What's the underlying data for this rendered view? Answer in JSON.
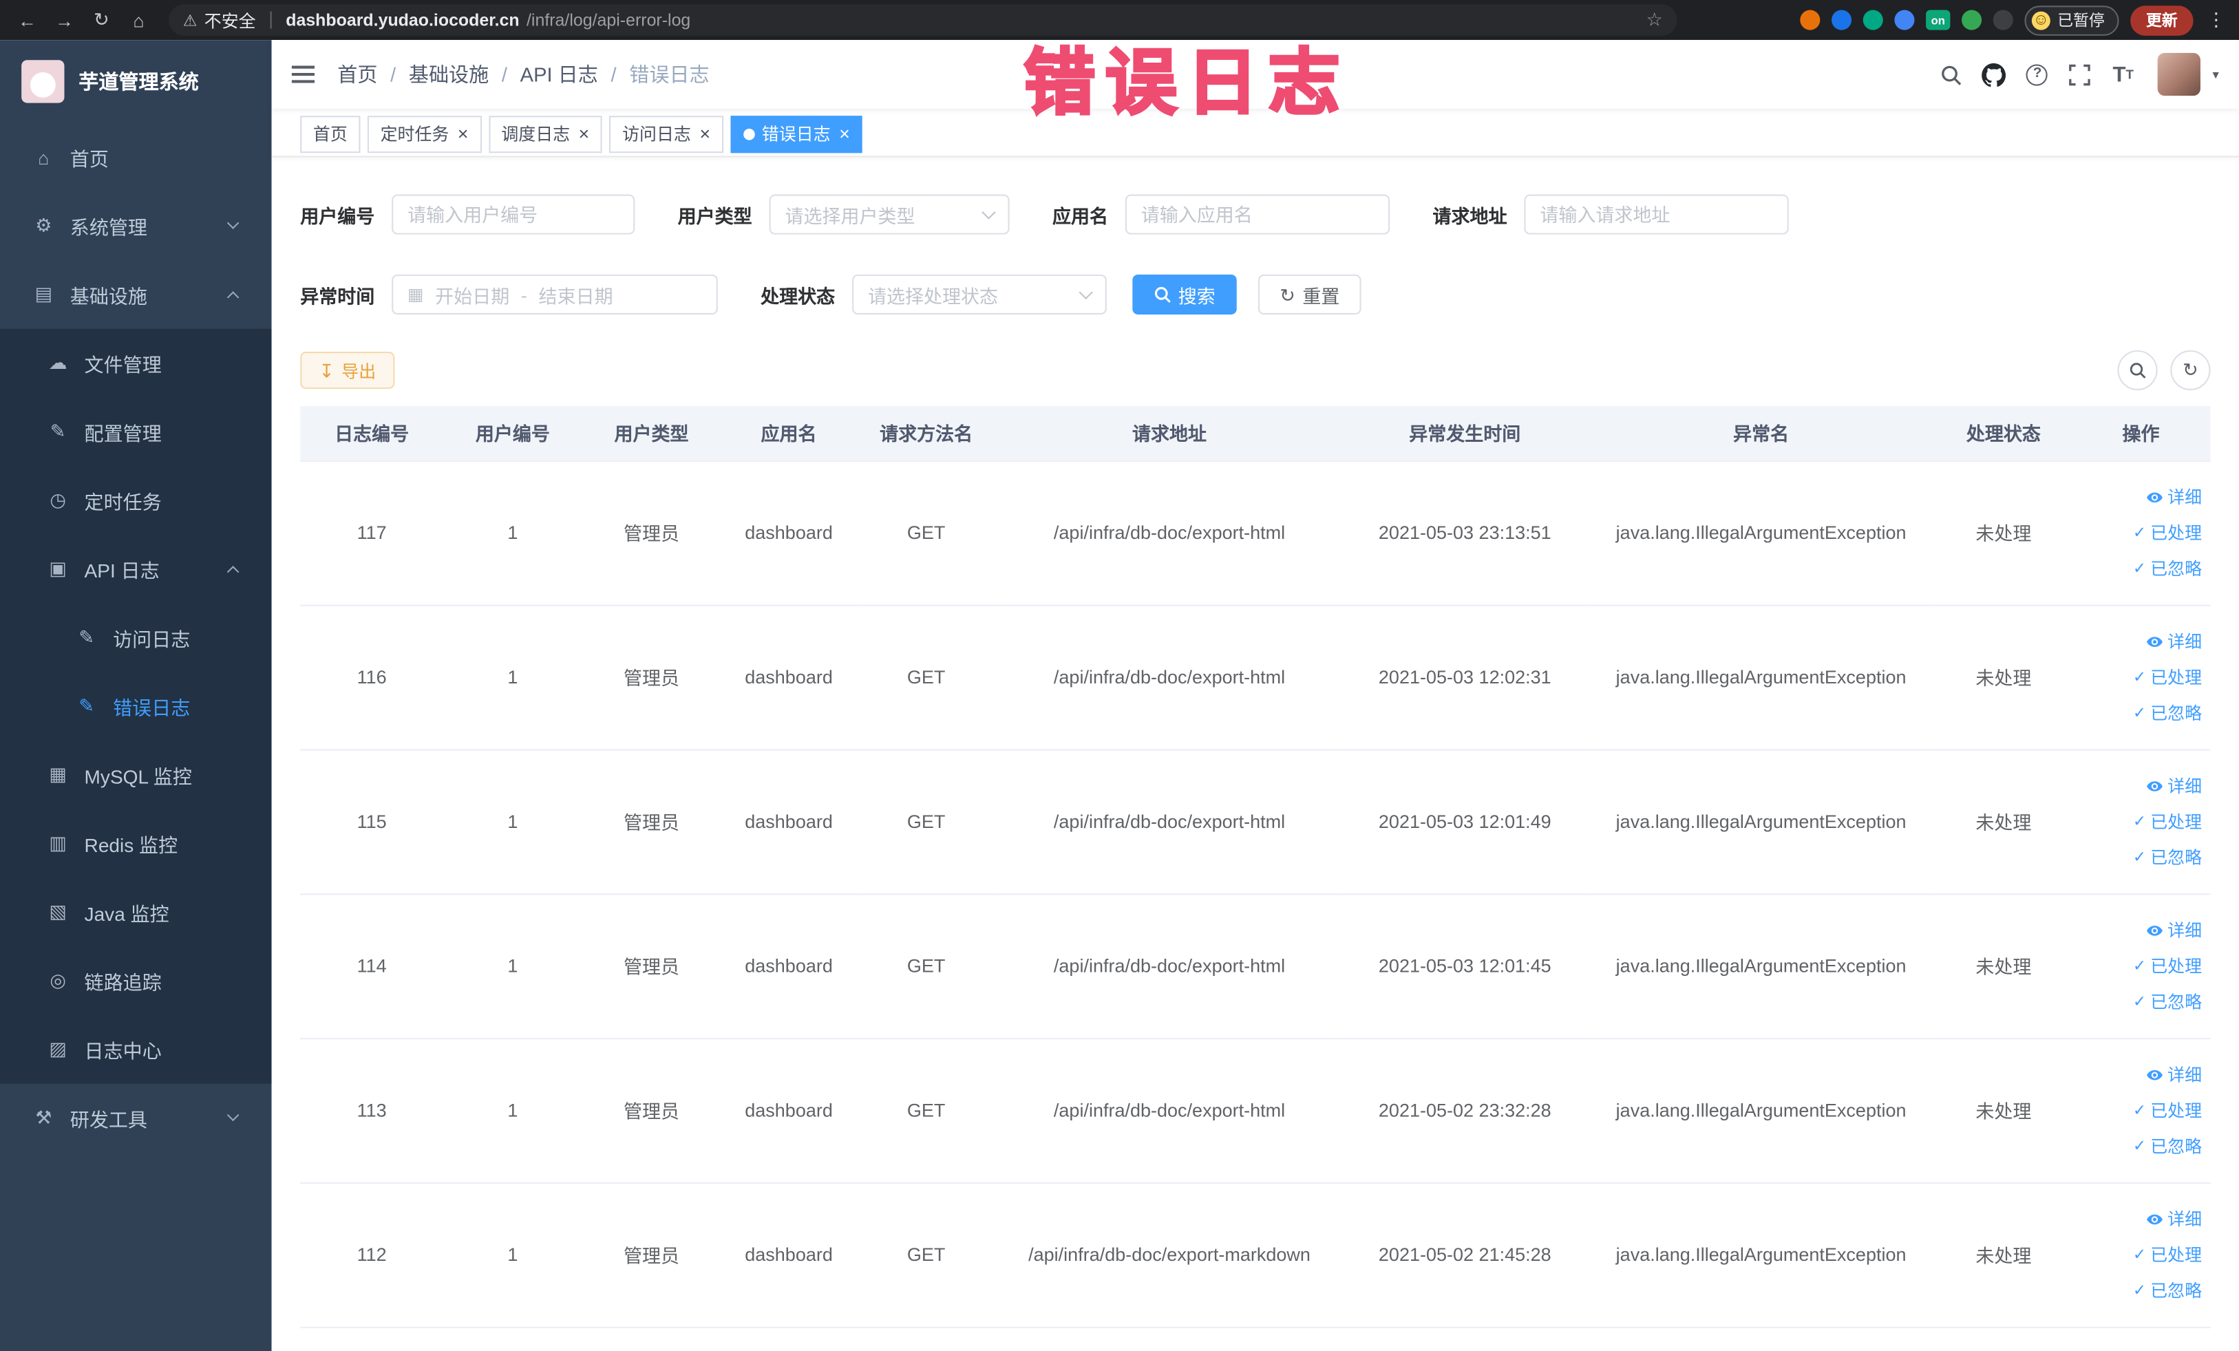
{
  "colors": {
    "accent": "#409eff",
    "sidebar_bg": "#304156",
    "annotation": "#ee3f68",
    "warning": "#e6a23c"
  },
  "annotation": "错误日志",
  "browser": {
    "security_label": "不安全",
    "url_domain": "dashboard.yudao.iocoder.cn",
    "url_path": "/infra/log/api-error-log",
    "paused_badge": "已暂停",
    "update_button": "更新",
    "extensions": [
      {
        "name": "extension-orange",
        "color": "#e8710a"
      },
      {
        "name": "extension-drop",
        "color": "#1a73e8"
      },
      {
        "name": "extension-teal",
        "color": "#00a884"
      },
      {
        "name": "extension-grid",
        "color": "#4285f4"
      },
      {
        "name": "extension-on-badge",
        "color": "#0ca678",
        "label": "on"
      },
      {
        "name": "extension-leaf",
        "color": "#34a853"
      },
      {
        "name": "extension-paw",
        "color": "#3c4043"
      }
    ]
  },
  "sidebar": {
    "logo_title": "芋道管理系统",
    "items": [
      {
        "key": "home",
        "label": "首页",
        "icon": "home-icon",
        "level": 1
      },
      {
        "key": "system",
        "label": "系统管理",
        "icon": "gear-icon",
        "level": 1,
        "arrow": "down"
      },
      {
        "key": "infra",
        "label": "基础设施",
        "icon": "infra-icon",
        "level": 1,
        "arrow": "up"
      },
      {
        "key": "file-manage",
        "label": "文件管理",
        "icon": "cloud-icon",
        "level": 2
      },
      {
        "key": "config-manage",
        "label": "配置管理",
        "icon": "edit-icon",
        "level": 2
      },
      {
        "key": "scheduled-job",
        "label": "定时任务",
        "icon": "clock-icon",
        "level": 2
      },
      {
        "key": "api-log",
        "label": "API 日志",
        "icon": "api-log-icon",
        "level": 2,
        "arrow": "up"
      },
      {
        "key": "access-log",
        "label": "访问日志",
        "icon": "access-log-icon",
        "level": 3
      },
      {
        "key": "error-log",
        "label": "错误日志",
        "icon": "error-log-icon",
        "level": 3,
        "active": true
      },
      {
        "key": "mysql-monitor",
        "label": "MySQL 监控",
        "icon": "mysql-icon",
        "level": 2
      },
      {
        "key": "redis-monitor",
        "label": "Redis 监控",
        "icon": "redis-icon",
        "level": 2
      },
      {
        "key": "java-monitor",
        "label": "Java 监控",
        "icon": "java-icon",
        "level": 2
      },
      {
        "key": "link-trace",
        "label": "链路追踪",
        "icon": "trace-icon",
        "level": 2
      },
      {
        "key": "log-center",
        "label": "日志中心",
        "icon": "log-center-icon",
        "level": 2
      },
      {
        "key": "dev-tools",
        "label": "研发工具",
        "icon": "tools-icon",
        "level": 1,
        "arrow": "down"
      }
    ]
  },
  "header": {
    "breadcrumb": [
      "首页",
      "基础设施",
      "API 日志",
      "错误日志"
    ]
  },
  "tabs": [
    {
      "label": "首页",
      "closable": false,
      "active": false
    },
    {
      "label": "定时任务",
      "closable": true,
      "active": false
    },
    {
      "label": "调度日志",
      "closable": true,
      "active": false
    },
    {
      "label": "访问日志",
      "closable": true,
      "active": false
    },
    {
      "label": "错误日志",
      "closable": true,
      "active": true
    }
  ],
  "filters": {
    "user_id_label": "用户编号",
    "user_id_placeholder": "请输入用户编号",
    "user_type_label": "用户类型",
    "user_type_placeholder": "请选择用户类型",
    "app_name_label": "应用名",
    "app_name_placeholder": "请输入应用名",
    "request_url_label": "请求地址",
    "request_url_placeholder": "请输入请求地址",
    "exception_time_label": "异常时间",
    "date_start_placeholder": "开始日期",
    "date_separator": "-",
    "date_end_placeholder": "结束日期",
    "process_status_label": "处理状态",
    "process_status_placeholder": "请选择处理状态",
    "search_button": "搜索",
    "reset_button": "重置"
  },
  "toolbar": {
    "export_button": "导出"
  },
  "table": {
    "columns": [
      "日志编号",
      "用户编号",
      "用户类型",
      "应用名",
      "请求方法名",
      "请求地址",
      "异常发生时间",
      "异常名",
      "处理状态",
      "操作"
    ],
    "rows": [
      {
        "log_id": "117",
        "user_id": "1",
        "user_type": "管理员",
        "app_name": "dashboard",
        "method": "GET",
        "url": "/api/infra/db-doc/export-html",
        "time": "2021-05-03 23:13:51",
        "exception": "java.lang.IllegalArgumentException",
        "status": "未处理"
      },
      {
        "log_id": "116",
        "user_id": "1",
        "user_type": "管理员",
        "app_name": "dashboard",
        "method": "GET",
        "url": "/api/infra/db-doc/export-html",
        "time": "2021-05-03 12:02:31",
        "exception": "java.lang.IllegalArgumentException",
        "status": "未处理"
      },
      {
        "log_id": "115",
        "user_id": "1",
        "user_type": "管理员",
        "app_name": "dashboard",
        "method": "GET",
        "url": "/api/infra/db-doc/export-html",
        "time": "2021-05-03 12:01:49",
        "exception": "java.lang.IllegalArgumentException",
        "status": "未处理"
      },
      {
        "log_id": "114",
        "user_id": "1",
        "user_type": "管理员",
        "app_name": "dashboard",
        "method": "GET",
        "url": "/api/infra/db-doc/export-html",
        "time": "2021-05-03 12:01:45",
        "exception": "java.lang.IllegalArgumentException",
        "status": "未处理"
      },
      {
        "log_id": "113",
        "user_id": "1",
        "user_type": "管理员",
        "app_name": "dashboard",
        "method": "GET",
        "url": "/api/infra/db-doc/export-html",
        "time": "2021-05-02 23:32:28",
        "exception": "java.lang.IllegalArgumentException",
        "status": "未处理"
      },
      {
        "log_id": "112",
        "user_id": "1",
        "user_type": "管理员",
        "app_name": "dashboard",
        "method": "GET",
        "url": "/api/infra/db-doc/export-markdown",
        "time": "2021-05-02 21:45:28",
        "exception": "java.lang.IllegalArgumentException",
        "status": "未处理"
      }
    ],
    "actions": {
      "detail": "详细",
      "processed": "已处理",
      "ignored": "已忽略"
    }
  }
}
